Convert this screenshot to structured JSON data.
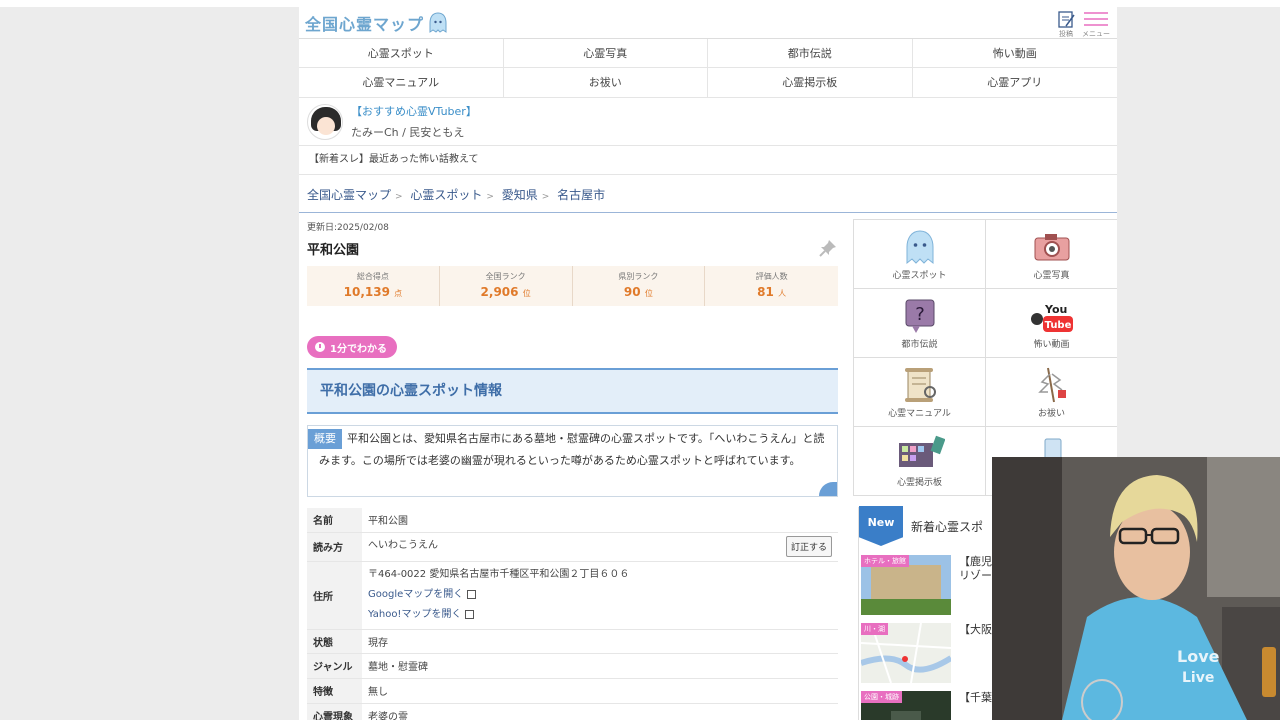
{
  "header": {
    "logo_text": "全国心霊マップ",
    "post_label": "投稿",
    "menu_label": "メニュー"
  },
  "nav": [
    "心霊スポット",
    "心霊写真",
    "都市伝説",
    "怖い動画",
    "心霊マニュアル",
    "お祓い",
    "心霊掲示板",
    "心霊アプリ"
  ],
  "vtuber": {
    "heading": "【おすすめ心霊VTuber】",
    "name": "たみーCh / 民安ともえ"
  },
  "thread": "【新着スレ】最近あった怖い話教えて",
  "breadcrumb": [
    "全国心霊マップ",
    "心霊スポット",
    "愛知県",
    "名古屋市"
  ],
  "page": {
    "updated": "更新日:2025/02/08",
    "title": "平和公園"
  },
  "stats": [
    {
      "label": "総合得点",
      "value": "10,139",
      "unit": "点"
    },
    {
      "label": "全国ランク",
      "value": "2,906",
      "unit": "位"
    },
    {
      "label": "県別ランク",
      "value": "90",
      "unit": "位"
    },
    {
      "label": "評価人数",
      "value": "81",
      "unit": "人"
    }
  ],
  "badge": "1分でわかる",
  "section_title": "平和公園の心霊スポット情報",
  "overview": {
    "tag": "概要",
    "text": "平和公園とは、愛知県名古屋市にある墓地・慰霊碑の心霊スポットです。「へいわこうえん」と読みます。この場所では老婆の幽霊が現れるといった噂があるため心霊スポットと呼ばれています。"
  },
  "info": {
    "name_k": "名前",
    "name_v": "平和公園",
    "reading_k": "読み方",
    "reading_v": "へいわこうえん",
    "fix_button": "訂正する",
    "address_k": "住所",
    "address_v": "〒464-0022 愛知県名古屋市千種区平和公園２丁目６０６",
    "google_link": "Googleマップを開く",
    "yahoo_link": "Yahoo!マップを開く",
    "status_k": "状態",
    "status_v": "現存",
    "genre_k": "ジャンル",
    "genre_v": "墓地・慰霊碑",
    "feature_k": "特徴",
    "feature_v": "無し",
    "phenomenon_k": "心霊現象",
    "phenomenon_v": "老婆の霊"
  },
  "sidebar": {
    "categories": [
      {
        "label": "心霊スポット",
        "icon": "ghost-icon"
      },
      {
        "label": "心霊写真",
        "icon": "camera-icon"
      },
      {
        "label": "都市伝説",
        "icon": "question-icon"
      },
      {
        "label": "怖い動画",
        "icon": "youtube-icon"
      },
      {
        "label": "心霊マニュアル",
        "icon": "scroll-icon"
      },
      {
        "label": "お祓い",
        "icon": "purification-icon"
      },
      {
        "label": "心霊掲示板",
        "icon": "board-icon"
      },
      {
        "label": "",
        "icon": "phone-app-icon"
      }
    ],
    "new_tag": "New",
    "new_title": "新着心霊スポ",
    "new_items": [
      {
        "category": "ホテル・旅館",
        "title": "【鹿児",
        "title2": "リゾー"
      },
      {
        "category": "川・湖",
        "title": "【大阪",
        "title2": ""
      },
      {
        "category": "公園・城跡",
        "title": "【千葉",
        "title2": ""
      }
    ]
  },
  "colors": {
    "accent_blue": "#6a9fd6",
    "accent_pink": "#e86fc0",
    "score_orange": "#e07a2a"
  }
}
